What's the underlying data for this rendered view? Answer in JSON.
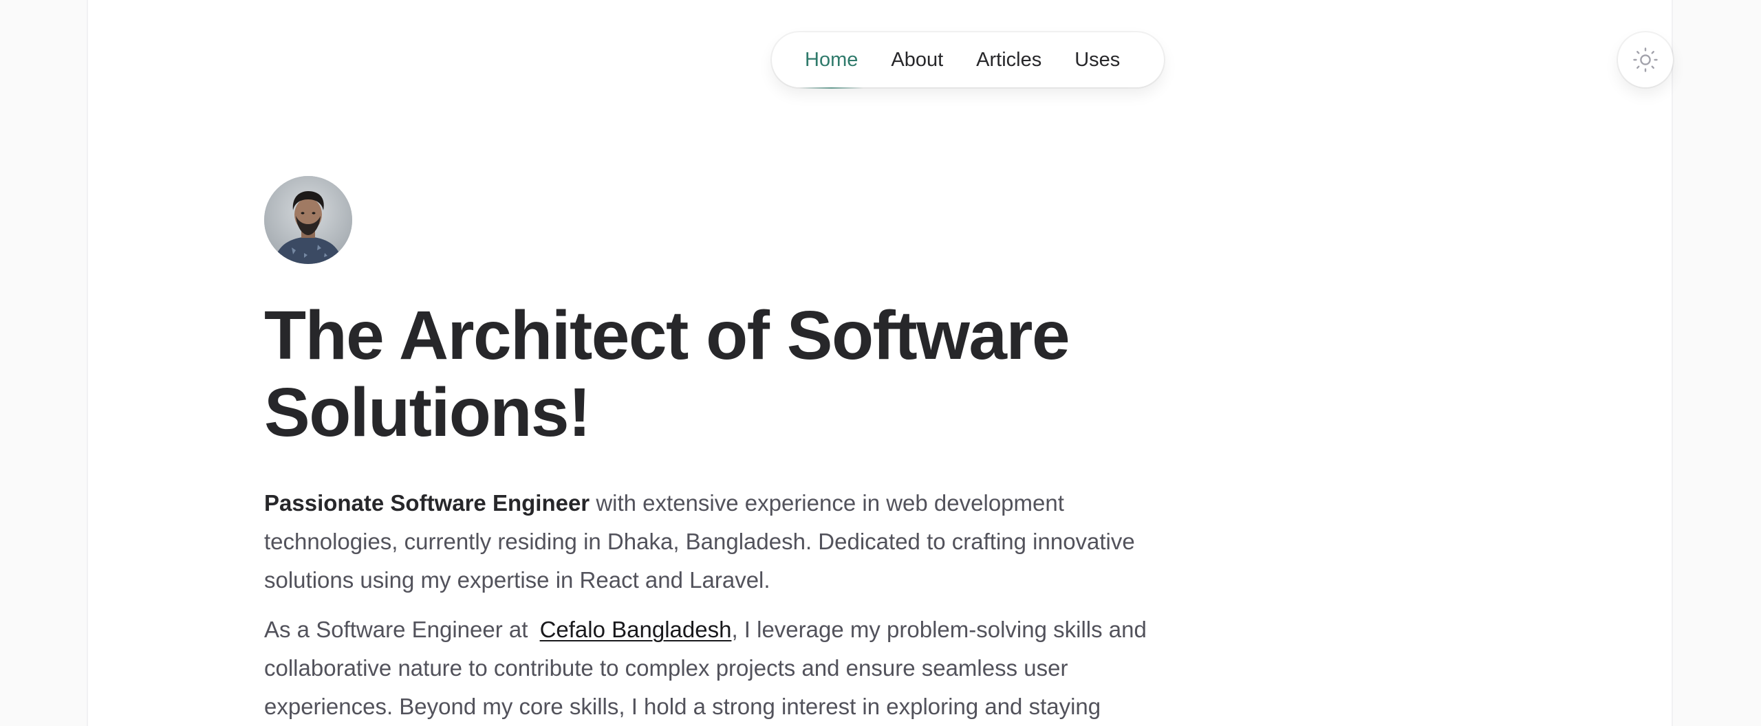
{
  "nav": {
    "items": [
      {
        "label": "Home",
        "active": true
      },
      {
        "label": "About",
        "active": false
      },
      {
        "label": "Articles",
        "active": false
      },
      {
        "label": "Uses",
        "active": false
      }
    ]
  },
  "theme_toggle": {
    "icon": "sun-icon"
  },
  "avatar": {
    "alt": "profile-photo"
  },
  "hero": {
    "title": "The Architect of Software Solutions!",
    "para1_bold": "Passionate Software Engineer",
    "para1_rest": " with extensive experience in web development technologies, currently residing in Dhaka, Bangladesh. Dedicated to crafting innovative solutions using my expertise in React and Laravel.",
    "para2_before": "As a Software Engineer at",
    "para2_link": "Cefalo Bangladesh",
    "para2_after": ", I leverage my problem-solving skills and collaborative nature to contribute to complex projects and ensure seamless user experiences. Beyond my core skills, I hold a strong interest in exploring and staying"
  },
  "colors": {
    "accent": "#2f7a6b",
    "text_primary": "#27272a",
    "text_body": "#52525b",
    "background": "#fafafa"
  }
}
